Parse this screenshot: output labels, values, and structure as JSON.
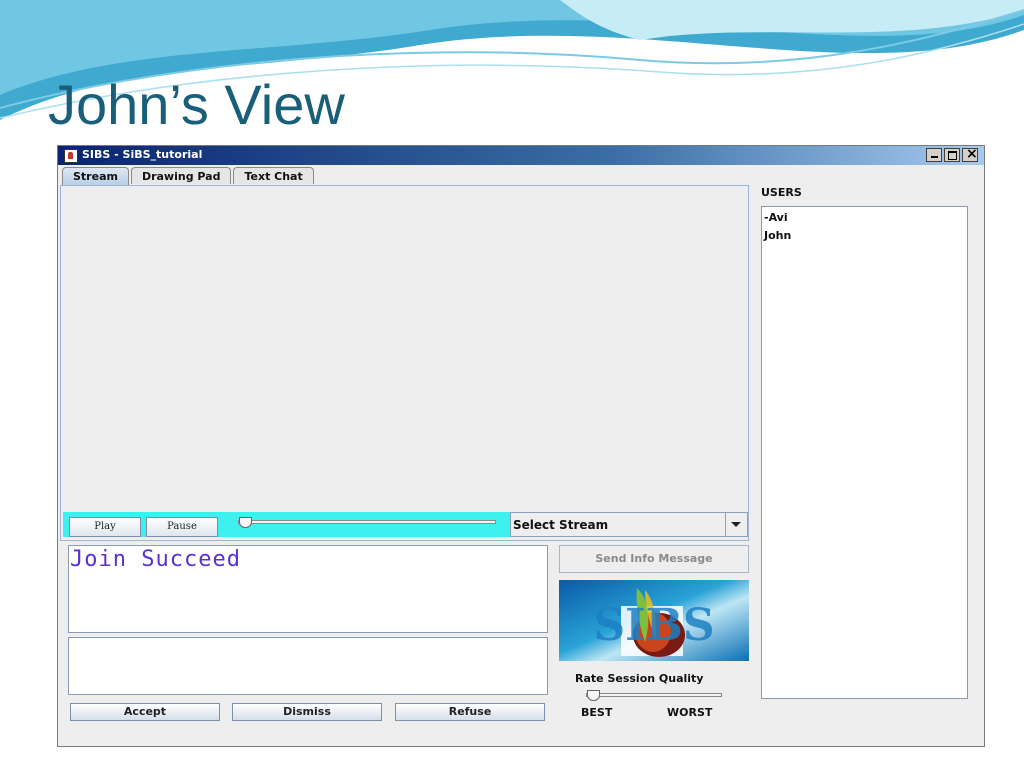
{
  "slide": {
    "title": "John’s View"
  },
  "window": {
    "title": "SIBS - SiBS_tutorial",
    "controls": [
      "minimize-icon",
      "maximize-icon",
      "close-icon"
    ]
  },
  "tabs": [
    {
      "label": "Stream",
      "active": true
    },
    {
      "label": "Drawing Pad",
      "active": false
    },
    {
      "label": "Text Chat",
      "active": false
    }
  ],
  "stream": {
    "play_label": "Play",
    "pause_label": "Pause",
    "position": 0,
    "select_label": "Select Stream"
  },
  "users": {
    "label": "USERS",
    "items": [
      "-Avi",
      "John"
    ]
  },
  "messages": {
    "text": "Join Succeed",
    "reply": ""
  },
  "actions": {
    "accept": "Accept",
    "dismiss": "Dismiss",
    "refuse": "Refuse"
  },
  "send_info": {
    "label": "Send Info Message",
    "enabled": false
  },
  "logo": {
    "text": "SIBS"
  },
  "rating": {
    "label": "Rate Session Quality",
    "best": "BEST",
    "worst": "WORST",
    "value": 0
  },
  "colors": {
    "title": "#1a5f7a",
    "message": "#5b2fd1",
    "controls_bar": "#3ff0f0"
  }
}
